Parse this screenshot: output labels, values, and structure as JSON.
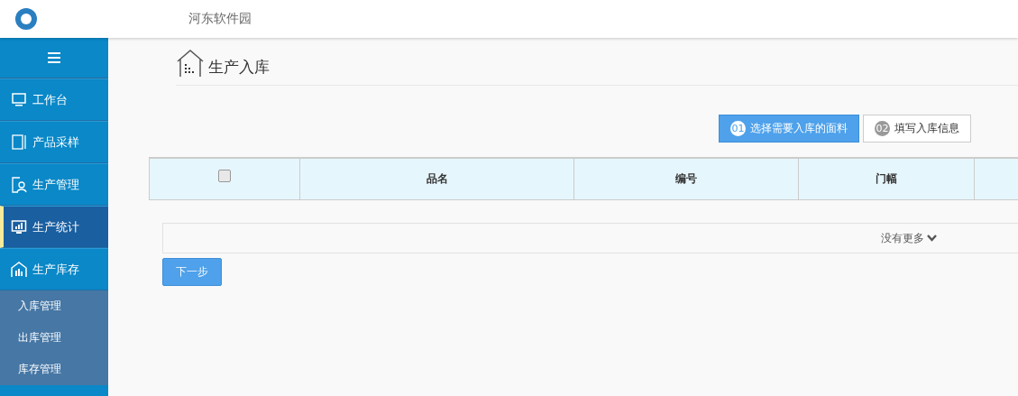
{
  "header": {
    "title": "河东软件园"
  },
  "sidebar": {
    "items": [
      {
        "label": "工作台",
        "selected": false
      },
      {
        "label": "产品采样",
        "selected": false
      },
      {
        "label": "生产管理",
        "selected": false
      },
      {
        "label": "生产统计",
        "selected": true
      },
      {
        "label": "生产库存",
        "selected": false,
        "expanded": true,
        "children": [
          {
            "label": "入库管理"
          },
          {
            "label": "出库管理"
          },
          {
            "label": "库存管理"
          }
        ]
      }
    ]
  },
  "page": {
    "title": "生产入库"
  },
  "steps": [
    {
      "number": "01",
      "label": "选择需要入库的面料",
      "selected": true
    },
    {
      "number": "02",
      "label": "填写入库信息",
      "selected": false
    }
  ],
  "table": {
    "select_all": {
      "checked": false
    },
    "columns": [
      "品名",
      "编号",
      "门幅"
    ],
    "footer": "没有更多"
  },
  "next_button": "下一步"
}
